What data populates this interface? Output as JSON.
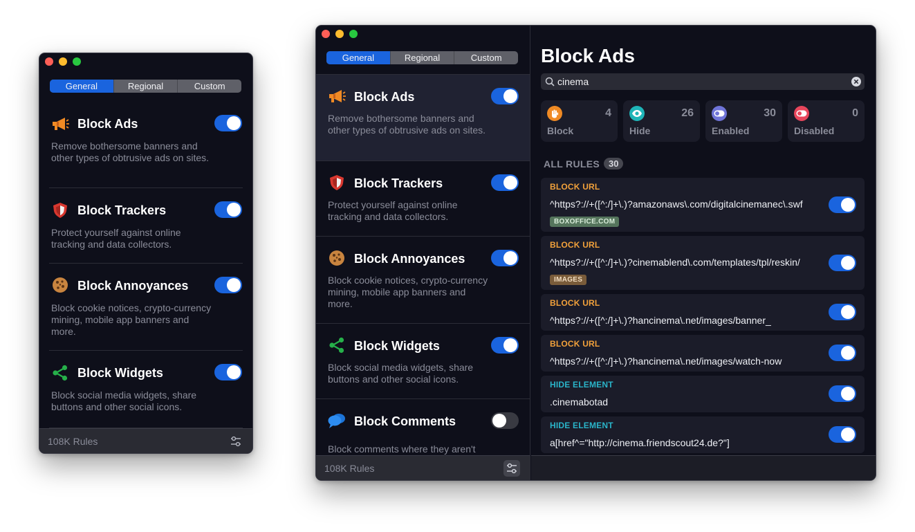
{
  "app": {
    "tabs": [
      "General",
      "Regional",
      "Custom"
    ],
    "active_tab": "General",
    "footer_rules": "108K Rules",
    "categories": [
      {
        "title": "Block Ads",
        "description": "Remove bothersome banners and other types of obtrusive ads on sites.",
        "enabled": true,
        "icon": "megaphone-icon"
      },
      {
        "title": "Block Trackers",
        "description": "Protect yourself against online tracking and data collectors.",
        "enabled": true,
        "icon": "shield-icon"
      },
      {
        "title": "Block Annoyances",
        "description": "Block cookie notices, crypto-currency mining, mobile app banners and more.",
        "enabled": true,
        "icon": "cookie-icon"
      },
      {
        "title": "Block Widgets",
        "description": "Block social media widgets, share buttons and other social icons.",
        "enabled": true,
        "icon": "share-icon"
      },
      {
        "title": "Block Comments",
        "description": "Block comments where they aren't the primary focus.",
        "enabled": false,
        "icon": "speech-bubbles-icon"
      }
    ]
  },
  "detail": {
    "title": "Block Ads",
    "search_value": "cinema",
    "stats": [
      {
        "label": "Block",
        "count": "4",
        "color": "#f08a24",
        "icon": "hand-icon"
      },
      {
        "label": "Hide",
        "count": "26",
        "color": "#1fb5b8",
        "icon": "eye-icon"
      },
      {
        "label": "Enabled",
        "count": "30",
        "color": "#6f74d8",
        "icon": "toggle-on-icon"
      },
      {
        "label": "Disabled",
        "count": "0",
        "color": "#e8465c",
        "icon": "toggle-off-icon"
      }
    ],
    "section_label": "ALL RULES",
    "section_count": "30",
    "rules": [
      {
        "type": "BLOCK URL",
        "kind": "url",
        "pattern": "^https?://+([^:/]+\\.)?amazonaws\\.com/digitalcinemanec\\.swf",
        "tag": "BOXOFFICE.COM",
        "tag_kind": "green",
        "enabled": true
      },
      {
        "type": "BLOCK URL",
        "kind": "url",
        "pattern": "^https?://+([^:/]+\\.)?cinemablend\\.com/templates/tpl/reskin/",
        "tag": "IMAGES",
        "tag_kind": "brown",
        "enabled": true
      },
      {
        "type": "BLOCK URL",
        "kind": "url",
        "pattern": "^https?://+([^:/]+\\.)?hancinema\\.net/images/banner_",
        "tag": "",
        "enabled": true
      },
      {
        "type": "BLOCK URL",
        "kind": "url",
        "pattern": "^https?://+([^:/]+\\.)?hancinema\\.net/images/watch-now",
        "tag": "",
        "enabled": true
      },
      {
        "type": "HIDE ELEMENT",
        "kind": "hide",
        "pattern": ".cinemabotad",
        "tag": "",
        "enabled": true
      },
      {
        "type": "HIDE ELEMENT",
        "kind": "hide",
        "pattern": "a[href^=\"http://cinema.friendscout24.de?\"]",
        "tag": "",
        "enabled": true
      }
    ]
  },
  "colors": {
    "accent": "#1a64de",
    "window_bg": "#0e0f1a",
    "card_bg": "#1b1c29"
  }
}
